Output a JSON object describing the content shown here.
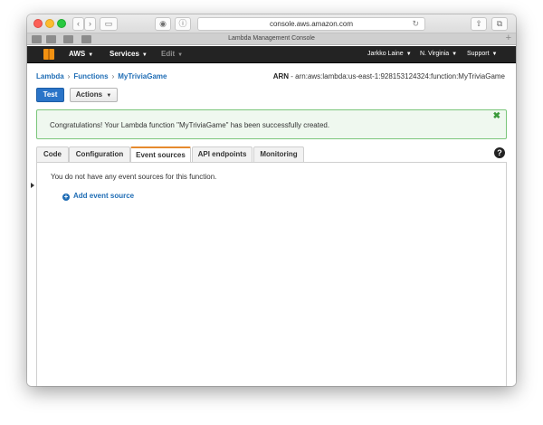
{
  "browser": {
    "url": "console.aws.amazon.com",
    "tab_title": "Lambda Management Console",
    "back_glyph": "‹",
    "forward_glyph": "›",
    "sidebar_glyph": "▭",
    "reload_glyph": "↻",
    "share_glyph": "⇧",
    "tabs_glyph": "⧉",
    "privacy_glyph": "◉",
    "info_glyph": "ⓘ",
    "new_tab_glyph": "+",
    "colors": {
      "close": "#fc5f57",
      "minimize": "#fdbc2e",
      "zoom": "#28c840"
    }
  },
  "aws_nav": {
    "brand": "AWS",
    "services": "Services",
    "edit": "Edit",
    "user": "Jarkko Laine",
    "region": "N. Virginia",
    "support": "Support",
    "caret": "▼",
    "logo_color": "#f29111"
  },
  "breadcrumb": {
    "items": [
      "Lambda",
      "Functions",
      "MyTriviaGame"
    ],
    "separator": "›"
  },
  "arn": {
    "label": "ARN",
    "value": " - arn:aws:lambda:us-east-1:928153124324:function:MyTriviaGame"
  },
  "buttons": {
    "test": "Test",
    "actions": "Actions",
    "actions_caret": "▼"
  },
  "alert": {
    "message": "Congratulations! Your Lambda function \"MyTriviaGame\" has been successfully created.",
    "close_glyph": "✖",
    "border_color": "#7bc67b"
  },
  "tabs": [
    {
      "label": "Code",
      "active": false
    },
    {
      "label": "Configuration",
      "active": false
    },
    {
      "label": "Event sources",
      "active": true
    },
    {
      "label": "API endpoints",
      "active": false
    },
    {
      "label": "Monitoring",
      "active": false
    }
  ],
  "help_glyph": "?",
  "event_sources": {
    "empty_message": "You do not have any event sources for this function.",
    "add_label": "Add event source",
    "add_glyph": "+"
  },
  "accent_color": "#e68a2e",
  "link_color": "#1f6db5",
  "primary_color": "#2a74c8"
}
